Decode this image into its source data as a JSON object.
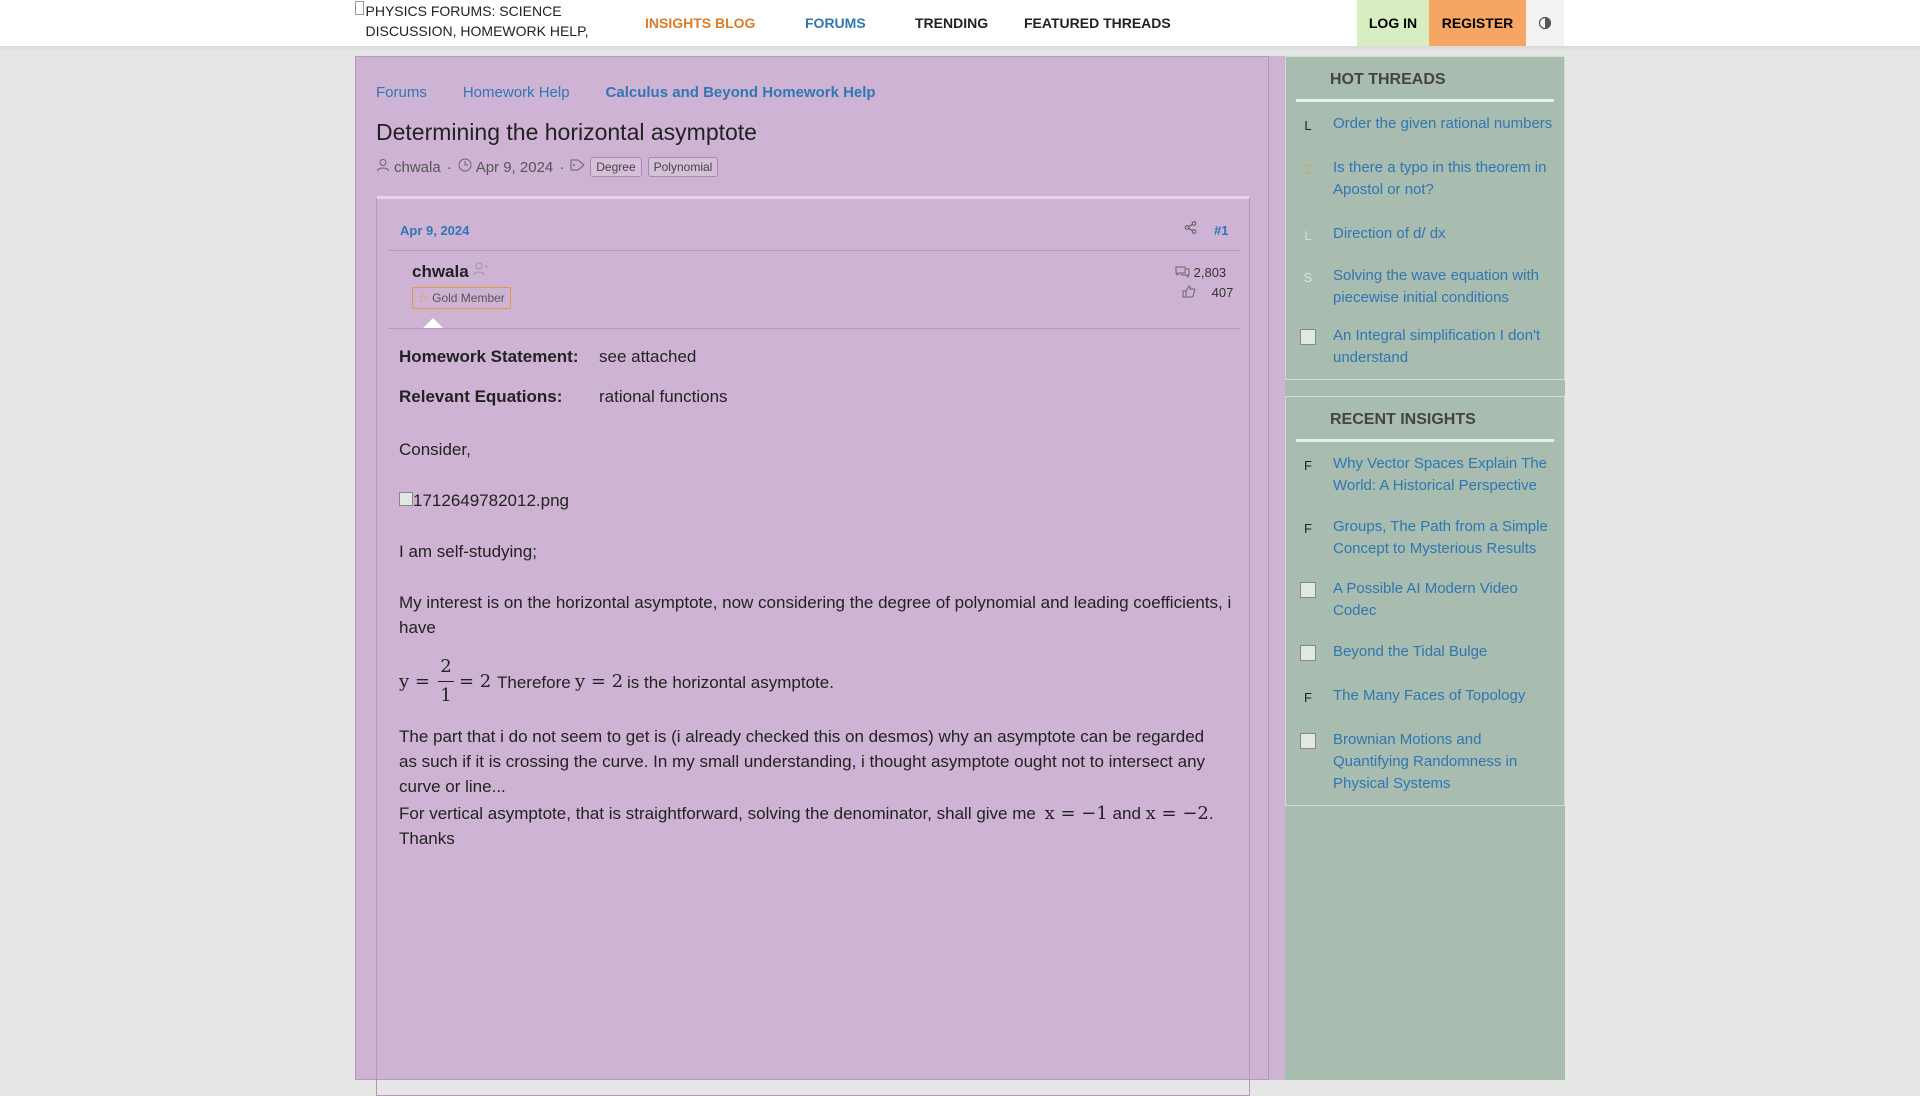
{
  "header": {
    "logo_alt": "PHYSICS FORUMS: SCIENCE DISCUSSION, HOMEWORK HELP,",
    "nav": {
      "insights": "INSIGHTS BLOG",
      "forums": "FORUMS",
      "trending": "TRENDING",
      "featured": "FEATURED THREADS"
    },
    "login": "LOG IN",
    "register": "REGISTER"
  },
  "breadcrumbs": [
    "Forums",
    "Homework Help",
    "Calculus and Beyond Homework Help"
  ],
  "thread": {
    "title": "Determining the horizontal asymptote",
    "author": "chwala",
    "date": "Apr 9, 2024",
    "tags": [
      "Degree",
      "Polynomial"
    ]
  },
  "post": {
    "date": "Apr 9, 2024",
    "number": "#1",
    "username": "chwala",
    "badge": "Gold Member",
    "messages": "2,803",
    "reactions": "407",
    "hw_statement_label": "Homework Statement:",
    "hw_statement": "see attached",
    "relevant_eq_label": "Relevant Equations:",
    "relevant_eq": "rational functions",
    "p_consider": "Consider,",
    "image_alt": "1712649782012.png",
    "p_self": "I am self-studying;",
    "p_interest": "My interest is on the horizontal asymptote, now considering the degree of polynomial and leading coefficients, i have",
    "eq_y": "y =",
    "eq_num": "2",
    "eq_den": "1",
    "eq_eq2": "= 2",
    "eq_therefore": "Therefore",
    "eq_y2": "y = 2",
    "eq_tail": "is the horizontal asymptote.",
    "p_part": "The part that i do not seem to get is (i already checked this on desmos) why an asymptote can be regarded as such if it is crossing the curve. In my small understanding, i thought asymptote ought not to intersect any curve or line...",
    "p_vertical_pre": "For vertical asymptote, that is straightforward, solving the denominator, shall give me",
    "p_vertical_x1": "x = −1",
    "p_vertical_and": "and",
    "p_vertical_x2": "x = −2",
    "p_vertical_end": ".",
    "p_thanks": "Thanks"
  },
  "hot_threads": {
    "title": "HOT THREADS",
    "items": [
      {
        "avatar": "L",
        "title": "Order the given rational numbers"
      },
      {
        "avatar": "Z",
        "title": "Is there a typo in this theorem in Apostol or not?"
      },
      {
        "avatar": "L",
        "title": "Direction of d/ dx"
      },
      {
        "avatar": "S",
        "title": "Solving the wave equation with piecewise initial conditions"
      },
      {
        "avatar": "",
        "title": "An Integral simplification I don't understand"
      }
    ]
  },
  "recent_insights": {
    "title": "RECENT INSIGHTS",
    "items": [
      {
        "avatar": "F",
        "title": "Why Vector Spaces Explain The World: A Historical Perspective"
      },
      {
        "avatar": "F",
        "title": "Groups, The Path from a Simple Concept to Mysterious Results"
      },
      {
        "avatar": "",
        "title": "A Possible AI Modern Video Codec"
      },
      {
        "avatar": "",
        "title": "Beyond the Tidal Bulge"
      },
      {
        "avatar": "F",
        "title": "The Many Faces of Topology"
      },
      {
        "avatar": "",
        "title": "Brownian Motions and Quantifying Randomness in Physical Systems"
      }
    ]
  },
  "colors": {
    "main_bg": "#cfb3d4",
    "sidebar_bg": "#a8bcaf",
    "link": "#2f77b3",
    "insights_orange": "#e07b24",
    "login_bg": "#d8edc0",
    "register_bg": "#f6a563"
  }
}
